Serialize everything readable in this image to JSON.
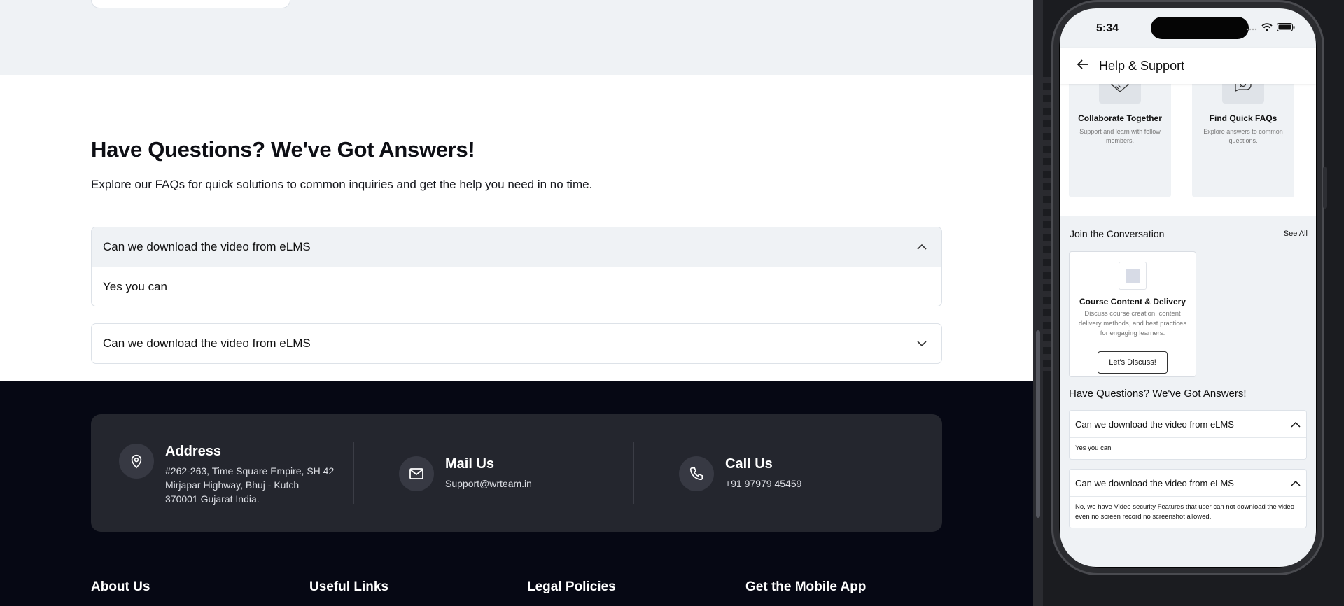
{
  "web": {
    "faq": {
      "title": "Have Questions? We've Got Answers!",
      "subtitle": "Explore our FAQs for quick solutions to common inquiries and get the help you need in no time.",
      "items": [
        {
          "question": "Can we download the video from eLMS",
          "answer": "Yes you can",
          "expanded": true
        },
        {
          "question": "Can we download the video from eLMS",
          "answer": "",
          "expanded": false
        }
      ]
    },
    "contact": {
      "address": {
        "heading": "Address",
        "line1": "#262-263, Time Square Empire, SH 42",
        "line2": "Mirjapar Highway, Bhuj - Kutch",
        "line3": "370001 Gujarat India."
      },
      "mail": {
        "heading": "Mail Us",
        "value": "Support@wrteam.in"
      },
      "call": {
        "heading": "Call Us",
        "value": "+91 97979 45459"
      }
    },
    "footer_headings": [
      "About Us",
      "Useful Links",
      "Legal Policies",
      "Get the Mobile App"
    ]
  },
  "mobile": {
    "status": {
      "time": "5:34"
    },
    "appbar": {
      "title": "Help & Support"
    },
    "features": [
      {
        "title": "Collaborate Together",
        "desc": "Support and learn with fellow members.",
        "icon": "handshake-icon"
      },
      {
        "title": "Find Quick FAQs",
        "desc": "Explore answers to common questions.",
        "icon": "search-chat-icon"
      }
    ],
    "join": {
      "title": "Join the Conversation",
      "see_all": "See All",
      "card": {
        "title": "Course Content & Delivery",
        "desc": "Discuss course creation, content delivery methods, and best practices for engaging learners.",
        "button": "Let's Discuss!"
      }
    },
    "faq": {
      "title": "Have Questions? We've Got Answers!",
      "items": [
        {
          "question": "Can we download the video from eLMS",
          "answer": "Yes you can"
        },
        {
          "question": "Can we download the video from eLMS",
          "answer": "No, we have Video security Features that user can not download the video even no screen record no screenshot allowed."
        }
      ]
    }
  },
  "colors": {
    "footer_bg": "#060814",
    "card_bg": "#24262e",
    "light_bg": "#eff2f5"
  }
}
